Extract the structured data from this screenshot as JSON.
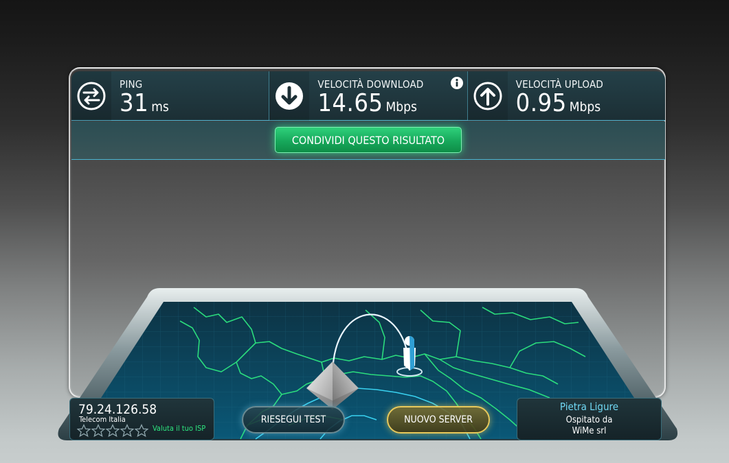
{
  "stats": {
    "ping": {
      "label": "PING",
      "value": "31",
      "unit": "ms",
      "icon": "swap-arrows-icon"
    },
    "download": {
      "label": "VELOCITÀ DOWNLOAD",
      "value": "14.65",
      "unit": "Mbps",
      "icon": "arrow-down-icon"
    },
    "upload": {
      "label": "VELOCITÀ UPLOAD",
      "value": "0.95",
      "unit": "Mbps",
      "icon": "arrow-up-icon"
    },
    "info_icon": "info-icon"
  },
  "share": {
    "label": "CONDIVIDI QUESTO RISULTATO"
  },
  "client": {
    "ip": "79.24.126.58",
    "isp": "Telecom Italia",
    "rating_stars": 5,
    "rate_label": "Valuta il tuo ISP"
  },
  "buttons": {
    "retest": "RIESEGUI TEST",
    "new_server": "NUOVO SERVER"
  },
  "server": {
    "city": "Pietra Ligure",
    "hosted_by": "Ospitato da",
    "sponsor": "WiMe srl"
  },
  "colors": {
    "accent_blue": "#4ab5d2",
    "share_green": "#17a85b",
    "map_border_green": "#2de57f",
    "new_server_gold": "#e8c95c"
  }
}
